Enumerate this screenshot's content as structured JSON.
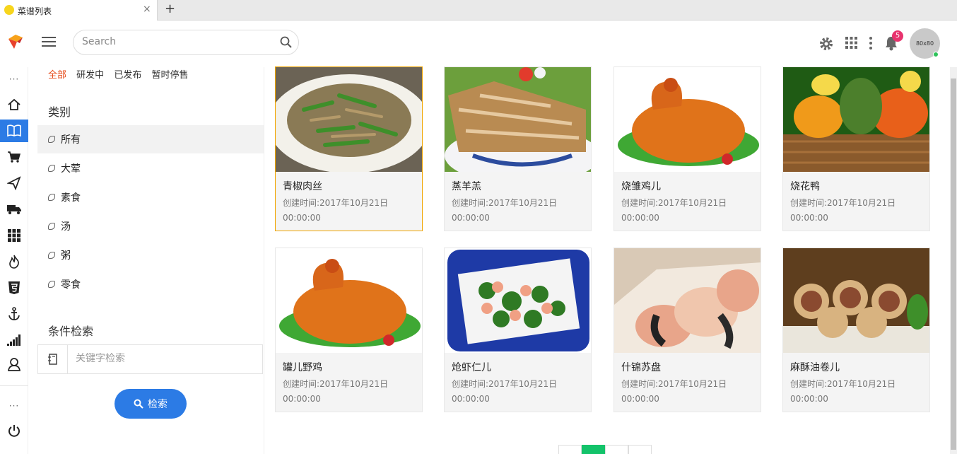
{
  "tab": {
    "title": "菜谱列表",
    "close": "×",
    "new_tab": "+"
  },
  "header": {
    "search_placeholder": "Search",
    "notifications": "5",
    "avatar": "80x80"
  },
  "rail": {
    "top_dots": "···",
    "bottom_dots": "···",
    "items": [
      "home-icon",
      "book-icon",
      "cart-icon",
      "send-icon",
      "truck-icon",
      "grid-icon",
      "fire-icon",
      "html5-icon",
      "anchor-icon",
      "signal-icon",
      "user-icon"
    ],
    "active": 1
  },
  "filters": [
    "全部",
    "研发中",
    "已发布",
    "暂时停售"
  ],
  "category_title": "类别",
  "categories": [
    "所有",
    "大荤",
    "素食",
    "汤",
    "粥",
    "零食"
  ],
  "search_title": "条件检索",
  "keyword_placeholder": "关键字检索",
  "search_button": "检索",
  "dishes": [
    {
      "name": "青椒肉丝",
      "created": "创建时间:2017年10月21日 00:00:00"
    },
    {
      "name": "蒸羊羔",
      "created": "创建时间:2017年10月21日 00:00:00"
    },
    {
      "name": "烧雏鸡儿",
      "created": "创建时间:2017年10月21日 00:00:00"
    },
    {
      "name": "烧花鸭",
      "created": "创建时间:2017年10月21日 00:00:00"
    },
    {
      "name": "罐儿野鸡",
      "created": "创建时间:2017年10月21日 00:00:00"
    },
    {
      "name": "炝虾仁儿",
      "created": "创建时间:2017年10月21日 00:00:00"
    },
    {
      "name": "什锦苏盘",
      "created": "创建时间:2017年10月21日 00:00:00"
    },
    {
      "name": "麻酥油卷儿",
      "created": "创建时间:2017年10月21日 00:00:00"
    }
  ],
  "pager": {
    "current": 1
  }
}
